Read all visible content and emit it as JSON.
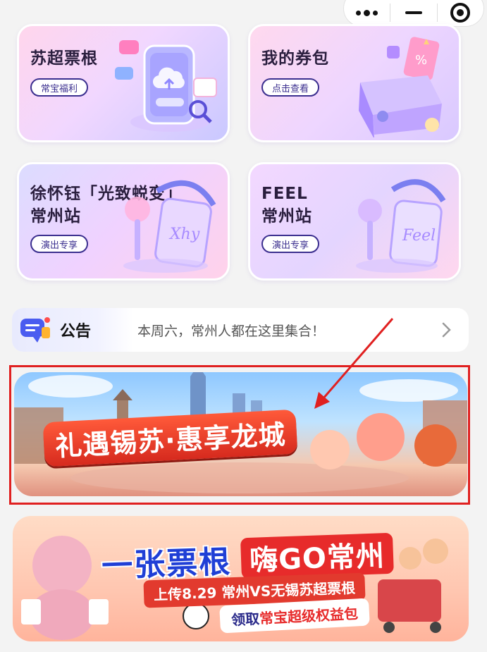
{
  "capsule": {
    "more_icon": "more-dots-icon",
    "minimize_icon": "minimize-icon",
    "close_icon": "target-close-icon"
  },
  "cards": [
    {
      "title": "苏超票根",
      "button": "常宝福利",
      "icon": "phone-upload-illustration"
    },
    {
      "title": "我的券包",
      "button": "点击查看",
      "icon": "gift-box-illustration"
    },
    {
      "title_line1": "徐怀钰「光致蜕变」",
      "title_line2": "常州站",
      "button": "演出专享",
      "icon": "lightstick-badge-illustration"
    },
    {
      "title_line1": "FEEL",
      "title_line2": "常州站",
      "button": "演出专享",
      "icon": "lightstick-badge-illustration"
    }
  ],
  "notice": {
    "label": "公告",
    "text": "本周六，常州人都在这里集合！",
    "icon": "announcement-icon"
  },
  "banner1": {
    "title": "礼遇锡苏·惠享龙城"
  },
  "banner2": {
    "line1_a": "一张票根",
    "line1_b": "嗨GO常州",
    "line2": "上传8.29 常州VS无锡苏超票根",
    "line3_a": "领取",
    "line3_b": "常宝超级权益包"
  },
  "colors": {
    "accent": "#3b2f8f",
    "highlight_border": "#e02020",
    "arrow": "#e02020"
  }
}
